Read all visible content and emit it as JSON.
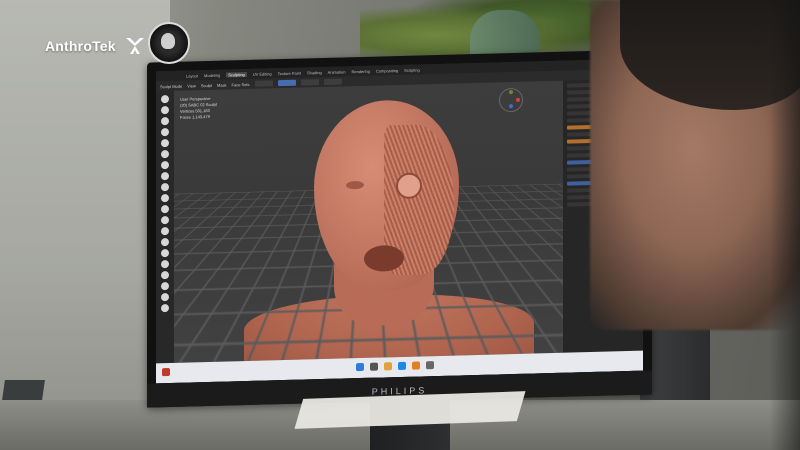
{
  "overlay": {
    "brand_name": "AnthroTek",
    "brand_icon": "anthrotek-logo-icon",
    "emblem_icon": "skull-emblem-icon"
  },
  "monitor": {
    "brand_label": "PHILIPS"
  },
  "blender": {
    "workspace_tabs": [
      "Layout",
      "Modeling",
      "Sculpting",
      "UV Editing",
      "Texture Paint",
      "Shading",
      "Animation",
      "Rendering",
      "Compositing",
      "Scripting"
    ],
    "active_tab": "Sculpting",
    "header_items": [
      "Sculpt Mode",
      "View",
      "Sculpt",
      "Mask",
      "Face Sets"
    ],
    "viewport_info": [
      "User Perspective",
      "(20) SABC 02 Sculpt",
      "Vertices  501,183",
      "Faces  1,143,479"
    ]
  },
  "colors": {
    "skin": "#c37863",
    "viewport_bg": "#3d3d3d",
    "accent_blue": "#476cb0"
  }
}
